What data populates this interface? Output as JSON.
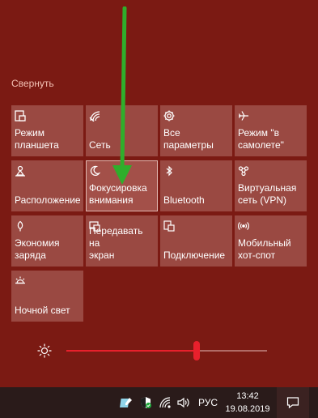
{
  "action_center": {
    "collapse_label": "Свернуть",
    "tiles": [
      {
        "label": "Режим\nпланшета",
        "icon": "tablet-mode-icon"
      },
      {
        "label": "Сеть",
        "icon": "network-icon"
      },
      {
        "label": "Все\nпараметры",
        "icon": "settings-gear-icon"
      },
      {
        "label": "Режим \"в\nсамолете\"",
        "icon": "airplane-icon"
      },
      {
        "label": "Расположение",
        "icon": "location-icon"
      },
      {
        "label": "Фокусировка\nвнимания",
        "icon": "moon-icon"
      },
      {
        "label": "Bluetooth",
        "icon": "bluetooth-icon"
      },
      {
        "label": "Виртуальная\nсеть (VPN)",
        "icon": "vpn-icon"
      },
      {
        "label": "Экономия\nзаряда",
        "icon": "battery-saver-icon"
      },
      {
        "label": "Передавать на\nэкран",
        "icon": "project-screen-icon"
      },
      {
        "label": "Подключение",
        "icon": "connect-icon"
      },
      {
        "label": "Мобильный\nхот-спот",
        "icon": "mobile-hotspot-icon"
      },
      {
        "label": "Ночной свет",
        "icon": "night-light-icon"
      }
    ],
    "brightness": {
      "icon": "brightness-icon",
      "level": 0.65
    }
  },
  "taskbar": {
    "language": "РУС",
    "time": "13:42",
    "date": "19.08.2019",
    "tray_icons": [
      "windows-ink-icon",
      "defender-shield-icon",
      "wifi-icon",
      "volume-icon"
    ]
  },
  "colors": {
    "accent": "#7b1a13",
    "tile": "#9a4942",
    "slider": "#e8202c",
    "annotation_arrow": "#2fae2b"
  }
}
